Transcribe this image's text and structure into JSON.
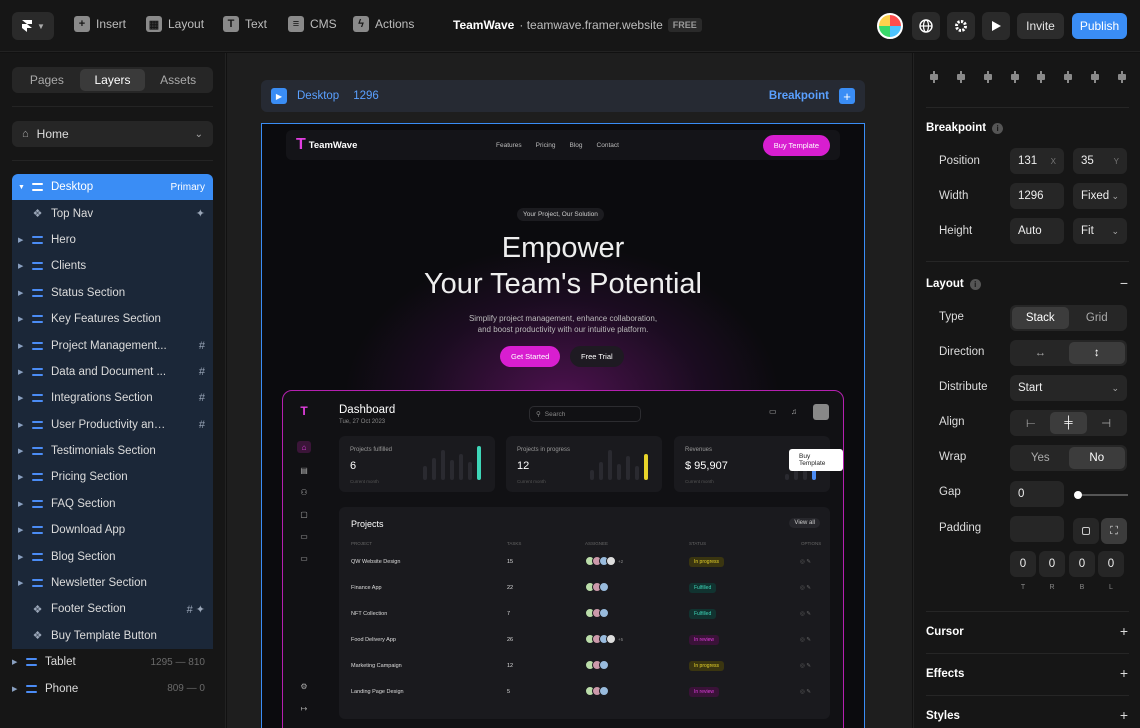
{
  "topbar": {
    "items": [
      {
        "label": "Insert",
        "icon": "plus-icon"
      },
      {
        "label": "Layout",
        "icon": "layout-icon"
      },
      {
        "label": "Text",
        "icon": "text-icon"
      },
      {
        "label": "CMS",
        "icon": "database-icon"
      },
      {
        "label": "Actions",
        "icon": "bolt-icon"
      }
    ],
    "site_name": "TeamWave",
    "site_domain": "· teamwave.framer.website",
    "plan_badge": "FREE",
    "invite_label": "Invite",
    "publish_label": "Publish"
  },
  "left_panel": {
    "tabs": [
      "Pages",
      "Layers",
      "Assets"
    ],
    "active_tab": "Layers",
    "page_selector": "Home",
    "layers": [
      {
        "label": "Desktop",
        "right": "Primary",
        "type": "stack",
        "expanded": true
      },
      {
        "label": "Top Nav",
        "right": "✦",
        "type": "component"
      },
      {
        "label": "Hero",
        "right": "",
        "type": "stack"
      },
      {
        "label": "Clients",
        "right": "",
        "type": "stack"
      },
      {
        "label": "Status Section",
        "right": "",
        "type": "stack"
      },
      {
        "label": "Key Features Section",
        "right": "",
        "type": "stack"
      },
      {
        "label": "Project Management...",
        "right": "#",
        "type": "stack"
      },
      {
        "label": "Data and Document ...",
        "right": "#",
        "type": "stack"
      },
      {
        "label": "Integrations Section",
        "right": "#",
        "type": "stack"
      },
      {
        "label": "User Productivity and...",
        "right": "#",
        "type": "stack"
      },
      {
        "label": "Testimonials Section",
        "right": "",
        "type": "stack"
      },
      {
        "label": "Pricing Section",
        "right": "",
        "type": "stack"
      },
      {
        "label": "FAQ Section",
        "right": "",
        "type": "stack"
      },
      {
        "label": "Download App",
        "right": "",
        "type": "stack"
      },
      {
        "label": "Blog Section",
        "right": "",
        "type": "stack"
      },
      {
        "label": "Newsletter Section",
        "right": "",
        "type": "stack"
      },
      {
        "label": "Footer Section",
        "right": "# ✦",
        "type": "component"
      },
      {
        "label": "Buy Template Button",
        "right": "",
        "type": "component"
      }
    ],
    "breakpoints": [
      {
        "label": "Tablet",
        "range": "1295 — 810"
      },
      {
        "label": "Phone",
        "range": "809 — 0"
      }
    ]
  },
  "canvas": {
    "breakpoint_name": "Desktop",
    "breakpoint_width": "1296",
    "breakpoint_action": "Breakpoint",
    "site": {
      "logo": "TeamWave",
      "nav_links": [
        "Features",
        "Pricing",
        "Blog",
        "Contact"
      ],
      "nav_cta": "Buy Template",
      "tagline": "Your Project, Our Solution",
      "heading_line1": "Empower",
      "heading_line2": "Your Team's Potential",
      "sub_line1": "Simplify project management, enhance collaboration,",
      "sub_line2": "and boost productivity with our intuitive platform.",
      "cta_primary": "Get Started",
      "cta_secondary": "Free Trial",
      "dashboard": {
        "title": "Dashboard",
        "date": "Tue, 27 Oct 2023",
        "search_placeholder": "Search",
        "kpis": [
          {
            "label": "Projects fulfilled",
            "value": "6",
            "caption": "Current month",
            "accent": "#3ed6b8"
          },
          {
            "label": "Projects in progress",
            "value": "12",
            "caption": "Current month",
            "accent": "#e8d42a"
          },
          {
            "label": "Revenues",
            "value": "$ 95,907",
            "caption": "Current month",
            "accent": "#4b8cf5"
          }
        ],
        "tooltip": "Buy Template",
        "projects_title": "Projects",
        "view_all": "View all",
        "columns": [
          "PROJECT",
          "TASKS",
          "ASSIGNEE",
          "STATUS",
          "OPTIONS"
        ],
        "rows": [
          {
            "name": "QW Website Design",
            "tasks": "15",
            "status": "In progress",
            "extra": "+2"
          },
          {
            "name": "Finance App",
            "tasks": "22",
            "status": "Fulfilled",
            "extra": ""
          },
          {
            "name": "NFT Collection",
            "tasks": "7",
            "status": "Fulfilled",
            "extra": ""
          },
          {
            "name": "Food Delivery App",
            "tasks": "26",
            "status": "In review",
            "extra": "+5"
          },
          {
            "name": "Marketing Campaign",
            "tasks": "12",
            "status": "In progress",
            "extra": ""
          },
          {
            "name": "Landing Page Design",
            "tasks": "5",
            "status": "In review",
            "extra": ""
          }
        ],
        "status_colors": {
          "In progress": "#e8d42a",
          "Fulfilled": "#3ed6b8",
          "In review": "#e23ee0"
        }
      }
    }
  },
  "right_panel": {
    "breakpoint_header": "Breakpoint",
    "position_label": "Position",
    "position_x": "131",
    "position_x_suffix": "X",
    "position_y": "35",
    "position_y_suffix": "Y",
    "width_label": "Width",
    "width_value": "1296",
    "width_mode": "Fixed",
    "height_label": "Height",
    "height_value": "Auto",
    "height_mode": "Fit",
    "layout_header": "Layout",
    "type_label": "Type",
    "type_options": [
      "Stack",
      "Grid"
    ],
    "type_active": "Stack",
    "direction_label": "Direction",
    "distribute_label": "Distribute",
    "distribute_value": "Start",
    "align_label": "Align",
    "wrap_label": "Wrap",
    "wrap_options": [
      "Yes",
      "No"
    ],
    "wrap_active": "No",
    "gap_label": "Gap",
    "gap_value": "0",
    "padding_label": "Padding",
    "padding_values": [
      "0",
      "0",
      "0",
      "0"
    ],
    "padding_sides": [
      "T",
      "R",
      "B",
      "L"
    ],
    "sections": [
      "Cursor",
      "Effects",
      "Styles"
    ]
  },
  "colors": {
    "accent": "#3a8df5",
    "brand": "#d81ed0"
  }
}
